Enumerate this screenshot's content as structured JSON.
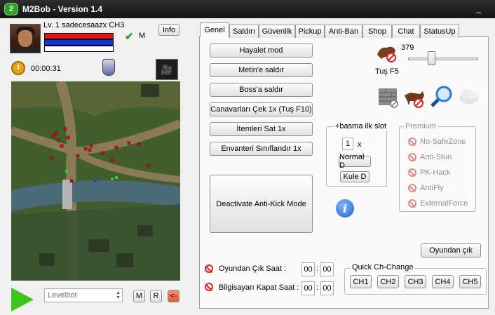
{
  "window": {
    "title": "M2Bob - Version 1.4",
    "logo_text": "2",
    "minimize": "_"
  },
  "character": {
    "level_line": "Lv. 1 sadecesaazx CH3",
    "mode_label": "M",
    "info_button": "Info"
  },
  "timer": {
    "elapsed": "00:00:31"
  },
  "bottom": {
    "bot_select": "Levelbot",
    "m_button": "M",
    "r_button": "R",
    "back_button": "<-"
  },
  "tabs": [
    "Genel",
    "Saldırı",
    "Güvenlik",
    "Pickup",
    "Anti-Ban",
    "Shop",
    "Chat",
    "StatusUp"
  ],
  "active_tab": "Genel",
  "actions": {
    "hayalet": "Hayalet mod",
    "metin": "Metin'e saldır",
    "boss": "Boss'a saldır",
    "canavar": "Canavarları Çek 1x (Tuş F10)",
    "itemler": "İtemleri Sat 1x",
    "envanter": "Envanteri Sınıflandır 1x",
    "antikick": "Deactivate Anti-Kick Mode"
  },
  "mount": {
    "slider_value": "379",
    "slider_fraction": 0.3,
    "hotkey_label": "Tuş F5"
  },
  "basma": {
    "title": "+basma ilk slot",
    "slot_value": "1",
    "x_label": "x",
    "normal_button": "Normal D",
    "kule_button": "Kule D"
  },
  "premium": {
    "title": "Premium",
    "items": [
      "No-SafeZone",
      "Anti-Stun",
      "PK-Hack",
      "AntiFly",
      "ExternalForce"
    ]
  },
  "exit_game_button": "Oyundan çık",
  "schedule": {
    "exit_label": "Oyundan Çık Saat :",
    "exit_h": "00",
    "exit_m": "00",
    "shutdown_label": "Bilgisayarı Kapat Saat :",
    "shut_h": "00",
    "shut_m": "00",
    "colon": ":"
  },
  "quick_ch": {
    "title": "Quick Ch-Change",
    "channels": [
      "CH1",
      "CH2",
      "CH3",
      "CH4",
      "CH5"
    ]
  },
  "colors": {
    "hp": "#e11616",
    "mp": "#1233d8",
    "play": "#3dc51f",
    "accent_red": "#e85a3a"
  }
}
